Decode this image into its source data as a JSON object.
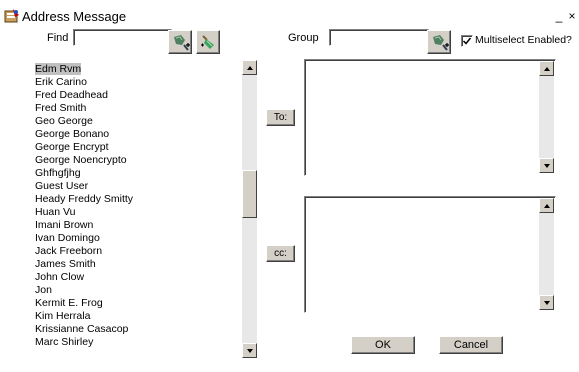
{
  "window": {
    "title": "Address Message",
    "minimize": "_",
    "close": "×"
  },
  "search": {
    "find_label": "Find",
    "find_value": "",
    "group_label": "Group",
    "group_value": ""
  },
  "toolbar": {
    "find_search_icon": "search-plus-icon",
    "find_clear_icon": "broom-icon",
    "group_search_icon": "search-plus-icon"
  },
  "multiselect": {
    "label": "Multiselect Enabled?",
    "checked": true
  },
  "contacts": [
    "Edm Rvm",
    "Erik Carino",
    "Fred Deadhead",
    "Fred Smith",
    "Geo George",
    "George Bonano",
    "George Encrypt",
    "George Noencrypto",
    "Ghfhgfjhg",
    "Guest User",
    "Heady Freddy Smitty",
    "Huan Vu",
    "Imani Brown",
    "Ivan Domingo",
    "Jack Freeborn",
    "James Smith",
    "John Clow",
    "Jon",
    "Kermit E. Frog",
    "Kim Herrala",
    "Krissianne Casacop",
    "Marc Shirley"
  ],
  "selected_contact": "Edm Rvm",
  "recipients": {
    "to_label": "To:",
    "to_value": "",
    "cc_label": "cc:",
    "cc_value": ""
  },
  "actions": {
    "ok_label": "OK",
    "cancel_label": "Cancel"
  }
}
